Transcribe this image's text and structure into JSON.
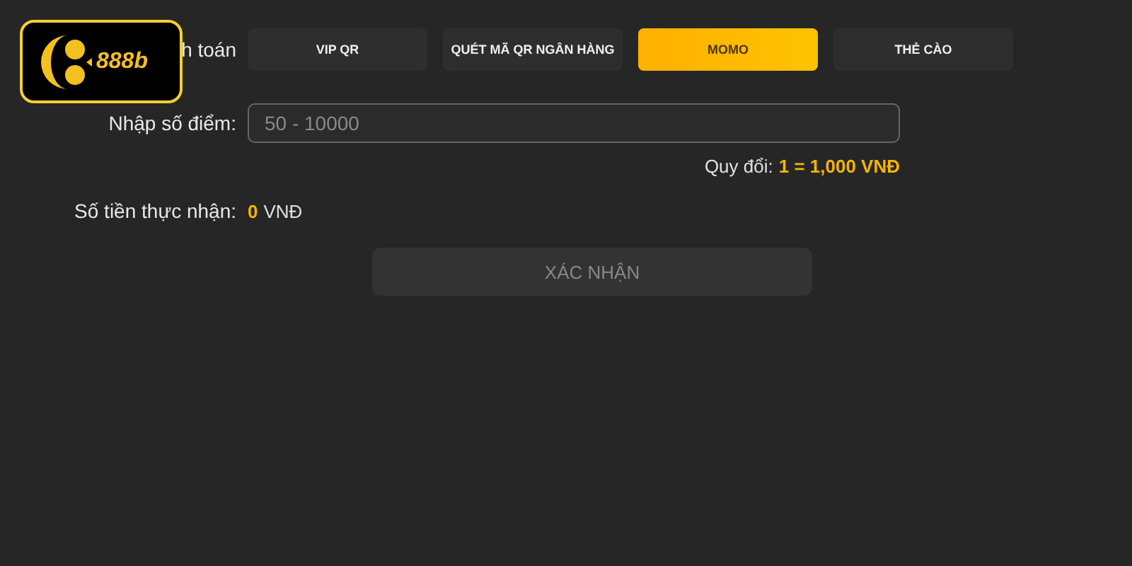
{
  "logo": {
    "text": "888b"
  },
  "payment_method": {
    "label": "h toán",
    "tabs": [
      {
        "label": "VIP QR",
        "selected": false
      },
      {
        "label": "QUÉT MÃ QR NGÂN HÀNG",
        "selected": false
      },
      {
        "label": "MOMO",
        "selected": true
      },
      {
        "label": "THẺ CÀO",
        "selected": false
      }
    ]
  },
  "points": {
    "label": "Nhập số điểm:",
    "placeholder": "50 - 10000"
  },
  "rate": {
    "label": "Quy đổi:",
    "value": "1 = 1,000 VNĐ"
  },
  "amount": {
    "label": "Số tiền thực nhận:",
    "value": "0",
    "currency": "VNĐ"
  },
  "confirm": {
    "label": "XÁC NHẬN",
    "disabled": true
  }
}
